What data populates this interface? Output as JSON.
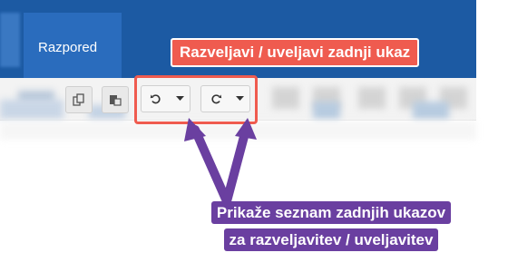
{
  "tabs": {
    "active_label": "Razpored"
  },
  "toolbar": {
    "copy_icon": "copy-icon",
    "paste_icon": "paste-icon",
    "undo_icon": "undo-icon",
    "undo_dropdown_icon": "chevron-down-icon",
    "redo_icon": "redo-icon",
    "redo_dropdown_icon": "chevron-down-icon"
  },
  "annotations": {
    "top_callout": "Razveljavi / uveljavi zadnji ukaz",
    "bottom_callout_line1": "Prikaže seznam zadnjih ukazov",
    "bottom_callout_line2": "za razveljavitev / uveljavitev"
  },
  "colors": {
    "top_bar": "#1c5aa3",
    "active_tab": "#2a6cbd",
    "highlight_red": "#ef5b4f",
    "callout_purple": "#6a3fa0"
  }
}
